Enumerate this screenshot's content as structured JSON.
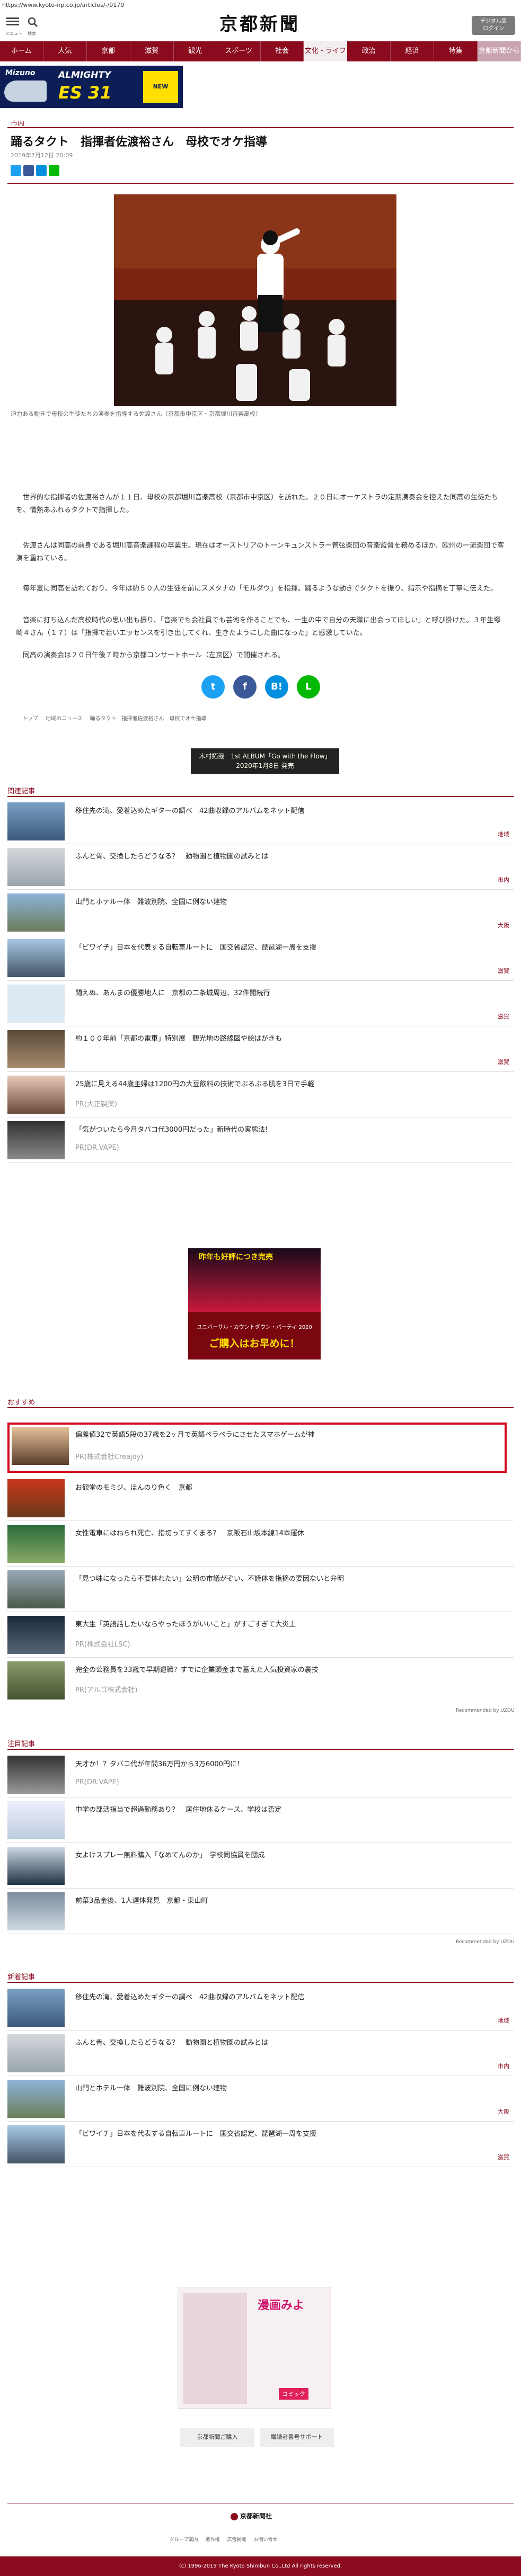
{
  "url": "https://www.kyoto-np.co.jp/articles/-/9170",
  "header": {
    "menu_label": "メニュー",
    "search_label": "検索",
    "logo": "京都新聞",
    "digital_line1": "デジタル版",
    "digital_line2": "ログイン"
  },
  "nav": [
    "ホーム",
    "人気",
    "京都",
    "滋賀",
    "観光",
    "スポーツ",
    "社会",
    "文化・ライフ",
    "政治",
    "経済",
    "特集",
    "京都新聞から"
  ],
  "ad_top": {
    "brand": "Mizuno",
    "line1": "ALMIGHTY",
    "line2": "ES 31",
    "badge": "NEW"
  },
  "article": {
    "category": "市内",
    "title": "踊るタクト　指揮者佐渡裕さん　母校でオケ指導",
    "date": "2019年7月12日 20:09",
    "caption": "迫力ある動きで母校の生徒たちの演奏を指導する佐渡さん（京都市中京区・京都堀川音楽高校）",
    "paragraphs": [
      "　世界的な指揮者の佐渡裕さんが１１日、母校の京都堀川音楽高校（京都市中京区）を訪れた。２０日にオーケストラの定期演奏会を控えた同高の生徒たちを、情熱あふれるタクトで指揮した。",
      "　佐渡さんは同高の前身である堀川高音楽課程の卒業生。現在はオーストリアのトーンキュンストラー管弦楽団の音楽監督を務めるほか、欧州の一流楽団で客演を重ねている。",
      "　毎年夏に同高を訪れており、今年は約５０人の生徒を前にスメタナの「モルダウ」を指揮。踊るような動きでタクトを振り、指示や指摘を丁寧に伝えた。",
      "　音楽に打ち込んだ高校時代の思い出も振り、「音楽でも会社員でも芸術を作ることでも、一生の中で自分の天職に出会ってほしい」と呼び掛けた。３年生塚崎４さん（１７）は「指揮で若いエッセンスを引き出してくれ、生きたようにした曲になった」と感激していた。",
      "　同高の演奏会は２０日午後７時から京都コンサートホール（左京区）で開催される。"
    ]
  },
  "breadcrumb": [
    "トップ",
    "地域のニュース",
    "踊るタクト　指揮者佐渡裕さん　母校でオケ指導"
  ],
  "ad_mid": {
    "line1": "木村拓哉　1st ALBUM「Go with the Flow」",
    "line2": "2020年1月8日 発売"
  },
  "related": {
    "heading": "関連記事",
    "items": [
      {
        "title": "移住先の滝、愛着込めたギターの調べ　42曲収録のアルバムをネット配信",
        "cat": "地域"
      },
      {
        "title": "ふんと骨、交換したらどうなる？　動物園と植物園の試みとは",
        "cat": "市内"
      },
      {
        "title": "山門とホテル一体　難波別院、全国に例ない建物",
        "cat": "大阪"
      },
      {
        "title": "「ビワイチ」日本を代表する自転車ルートに　国交省認定、琵琶湖一周を支援",
        "cat": "滋賀"
      },
      {
        "title": "闘えぬ、あんまの優勝地人に　京都の二条城周辺、32件開続行",
        "cat": "滋賀"
      },
      {
        "title": "約１００年前「京都の電車」特別展　観光地の路線図や絵はがきも",
        "cat": "滋賀"
      },
      {
        "title": "25歳に見える44歳主婦は1200円の大豆飲料の技術でぶるぷる肌を3日で手軽",
        "pr": "PR(大正製薬)"
      },
      {
        "title": "「気がついたら今月タバコ代3000円だった」新時代の実態法!",
        "pr": "PR(DR.VAPE)"
      }
    ]
  },
  "ad_square": {
    "line1": "昨年も好評につき完売",
    "line2": "ユニバーサル・カウントダウン・パーティ 2020",
    "line3": "ご購入はお早めに！"
  },
  "recommend": {
    "heading": "おすすめ",
    "items": [
      {
        "title": "偏差値32で英語5段の37歳を2ヶ月で英語ペラペラにさせたスマホゲームが神",
        "pr": "PR(株式会社Creajoy)"
      },
      {
        "title": "お観堂のモミジ、ほんのり色く　京都"
      },
      {
        "title": "女性電車にはねられ死亡、指切ってすくまる？　京阪石山坂本線14本運休"
      },
      {
        "title": "「見つ味になったら不要体れたい」公明の市議がぞい、不謹体を指摘の要因ないと弁明"
      },
      {
        "title": "東大生「英語話したいならやったほうがいいこと」がすごすぎて大炎上",
        "pr": "PR(株式会社LSC)"
      },
      {
        "title": "完全の公務員を33歳で早期退職？すでに企業頭金まで蓄えた人気投資家の裏技",
        "pr": "PR(アルゴ株式会社)"
      }
    ],
    "uzou": "Recommended by UZOU"
  },
  "attention": {
    "heading": "注目記事",
    "items": [
      {
        "title": "天才か！？タバコ代が年間36万円から3万6000円に！",
        "pr": "PR(DR.VAPE)"
      },
      {
        "title": "中学の部活指当で超過勤務あり？　居住地休るケース、学校は否定"
      },
      {
        "title": "女よけスプレー無料購入「なめてんのか」　学校同協員を団成"
      },
      {
        "title": "前菜3品金後、1人遅体発見　京都・東山町"
      }
    ],
    "uzou": "Recommended by UZOU"
  },
  "latest": {
    "heading": "新着記事",
    "items": [
      {
        "title": "移住先の滝、愛着込めたギターの調べ　42曲収録のアルバムをネット配信",
        "cat": "地域"
      },
      {
        "title": "ふんと骨、交換したらどうなる？　動物園と植物園の試みとは",
        "cat": "市内"
      },
      {
        "title": "山門とホテル一体　難波別院、全国に例ない建物",
        "cat": "大阪"
      },
      {
        "title": "「ビワイチ」日本を代表する自転車ルートに　国交省認定、琵琶湖一周を支援",
        "cat": "滋賀"
      }
    ]
  },
  "ad_manga": {
    "line1": "漫画みよ",
    "line2": "コミック"
  },
  "bottom_buttons": [
    "京都新聞ご購入",
    "購読者番号サポート"
  ],
  "footer": {
    "logo": "京都新聞社",
    "links": [
      "グループ案内",
      "著作権",
      "広告掲載",
      "お問い合せ"
    ],
    "copyright": "(c) 1996-2019 The Kyoto Shimbun Co.,Ltd All rights reserved."
  }
}
